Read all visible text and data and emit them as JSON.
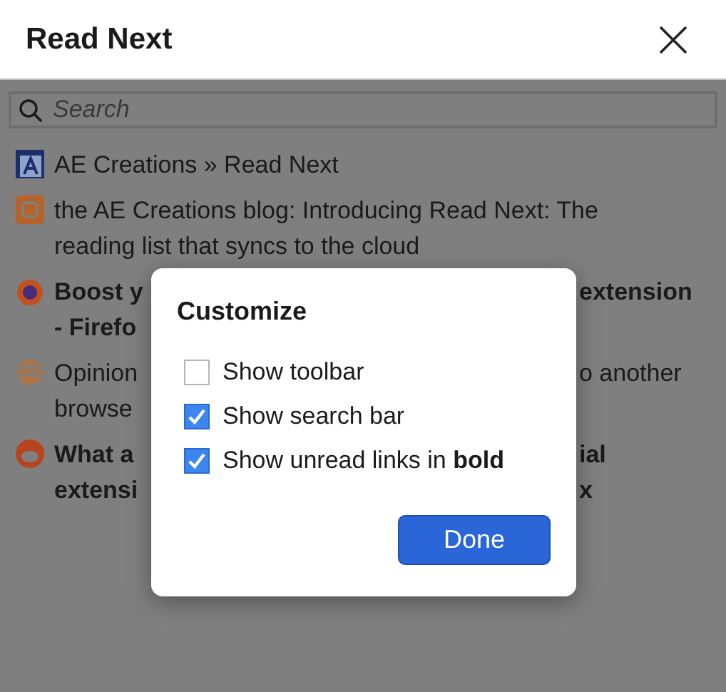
{
  "header": {
    "title": "Read Next"
  },
  "search": {
    "placeholder": "Search"
  },
  "items": [
    {
      "kind": "ae-logo",
      "unread": false,
      "lines": [
        {
          "left": "AE Creations » Read Next"
        }
      ]
    },
    {
      "kind": "blog",
      "unread": false,
      "lines": [
        {
          "left": "the AE Creations blog: Introducing Read Next: The"
        },
        {
          "left": "reading list that syncs to the cloud"
        }
      ]
    },
    {
      "kind": "fox",
      "unread": true,
      "lines": [
        {
          "left": "Boost y",
          "right": "extension"
        },
        {
          "left": "- Firefo"
        }
      ]
    },
    {
      "kind": "globe",
      "unread": false,
      "lines": [
        {
          "left": "Opinion",
          "right": "o another"
        },
        {
          "left": "browse"
        }
      ]
    },
    {
      "kind": "alien",
      "unread": true,
      "lines": [
        {
          "left": "What a",
          "right": "ial"
        },
        {
          "left": "extensi",
          "right": "x"
        }
      ]
    }
  ],
  "dialog": {
    "title": "Customize",
    "options": [
      {
        "label": "Show toolbar",
        "checked": false
      },
      {
        "label": "Show search bar",
        "checked": true
      },
      {
        "label": "Show unread links in **bold**",
        "checked": true
      }
    ],
    "button": "Done"
  }
}
